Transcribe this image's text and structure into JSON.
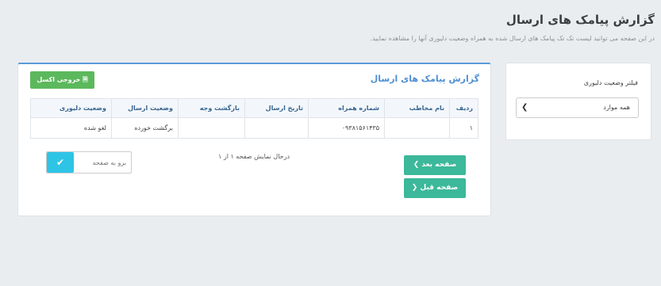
{
  "page": {
    "title": "گزارش پیامک های ارسال",
    "description": "در این صفحه می توانید لیست تک تک پیامک های ارسال شده به همراه وضعیت دلیوری آنها را مشاهده نمایید."
  },
  "filter": {
    "label": "فیلتر وضعیت دلیوری",
    "selected": "همه موارد"
  },
  "report": {
    "title": "گزارش پیامک های ارسال",
    "excel_label": "خروجی اکسل",
    "columns": [
      "ردیف",
      "نام مخاطب",
      "شماره همراه",
      "تاریخ ارسال",
      "بازگشت وجه",
      "وضعیت ارسال",
      "وضعیت دلیوری"
    ],
    "rows": [
      [
        "۱",
        "",
        "۰۹۳۸۱۵۶۱۴۳۵",
        "",
        "",
        "برگشت خورده",
        "لغو شده"
      ]
    ],
    "next_label": "صفحه بعد",
    "prev_label": "صفحه قبل",
    "page_info": "درحال نمایش صفحه ۱ از ۱",
    "goto_placeholder": "برو به صفحه"
  },
  "colors": {
    "accent": "#4f8fd1",
    "success": "#5cb85c",
    "nav": "#3cb89a",
    "info": "#2ec4e6"
  }
}
